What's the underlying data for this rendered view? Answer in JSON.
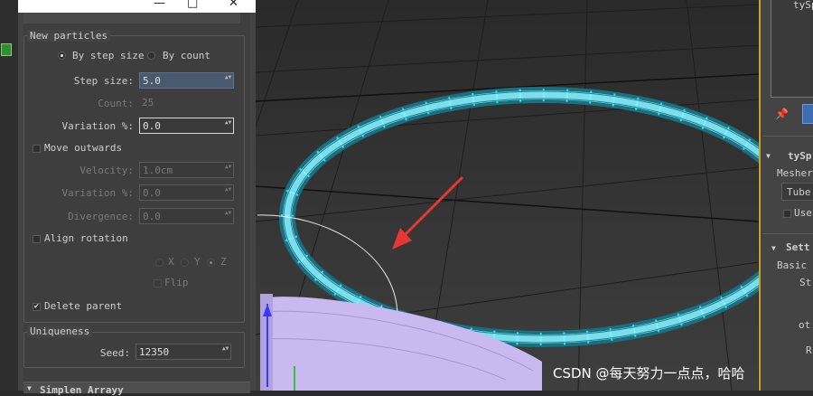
{
  "window": {
    "minimize_glyph": "—",
    "maximize_glyph": "□",
    "close_glyph": "✕"
  },
  "new_particles": {
    "title": "New particles",
    "by_step_size": {
      "label": "By step size",
      "selected": true
    },
    "by_count": {
      "label": "By count",
      "selected": false
    },
    "step_size": {
      "label": "Step size:",
      "value": "5.0"
    },
    "count": {
      "label": "Count:",
      "value": "25"
    },
    "variation": {
      "label": "Variation %:",
      "value": "0.0"
    },
    "move_outwards": {
      "label": "Move outwards",
      "checked": false
    },
    "velocity": {
      "label": "Velocity:",
      "value": "1.0cm"
    },
    "variation2": {
      "label": "Variation %:",
      "value": "0.0"
    },
    "divergence": {
      "label": "Divergence:",
      "value": "0.0"
    },
    "align_rotation": {
      "label": "Align rotation",
      "checked": false
    },
    "axis_x": "X",
    "axis_y": "Y",
    "axis_z": "Z",
    "flip": {
      "label": "Flip",
      "checked": false
    },
    "delete_parent": {
      "label": "Delete parent",
      "checked": true,
      "check_glyph": "✔"
    }
  },
  "uniqueness": {
    "title": "Uniqueness",
    "seed": {
      "label": "Seed:",
      "value": "12350"
    }
  },
  "next_rollout": {
    "expand_glyph": "▼",
    "label": "Simplen Arrayy"
  },
  "spinner_arrows": "▲▼",
  "command_panel": {
    "list_item": "tySp",
    "pin_glyph": "📌",
    "modifier_expand": "▼",
    "modifier_name": "tySp",
    "mesher_label": "Mesher",
    "dropdown_value": "Tube",
    "use_label": "Use",
    "settings_expand": "▼",
    "settings_label": "Sett",
    "basic_label": "Basic s",
    "str_label": "Str",
    "rot_label": "ot.",
    "r_label": "R"
  },
  "watermark": "CSDN @每天努力一点点，哈哈",
  "colors": {
    "ring": "#3fd8e8",
    "tube": "#c9b9f0",
    "arrow": "#e83535",
    "accent_border": "#c9a227"
  }
}
